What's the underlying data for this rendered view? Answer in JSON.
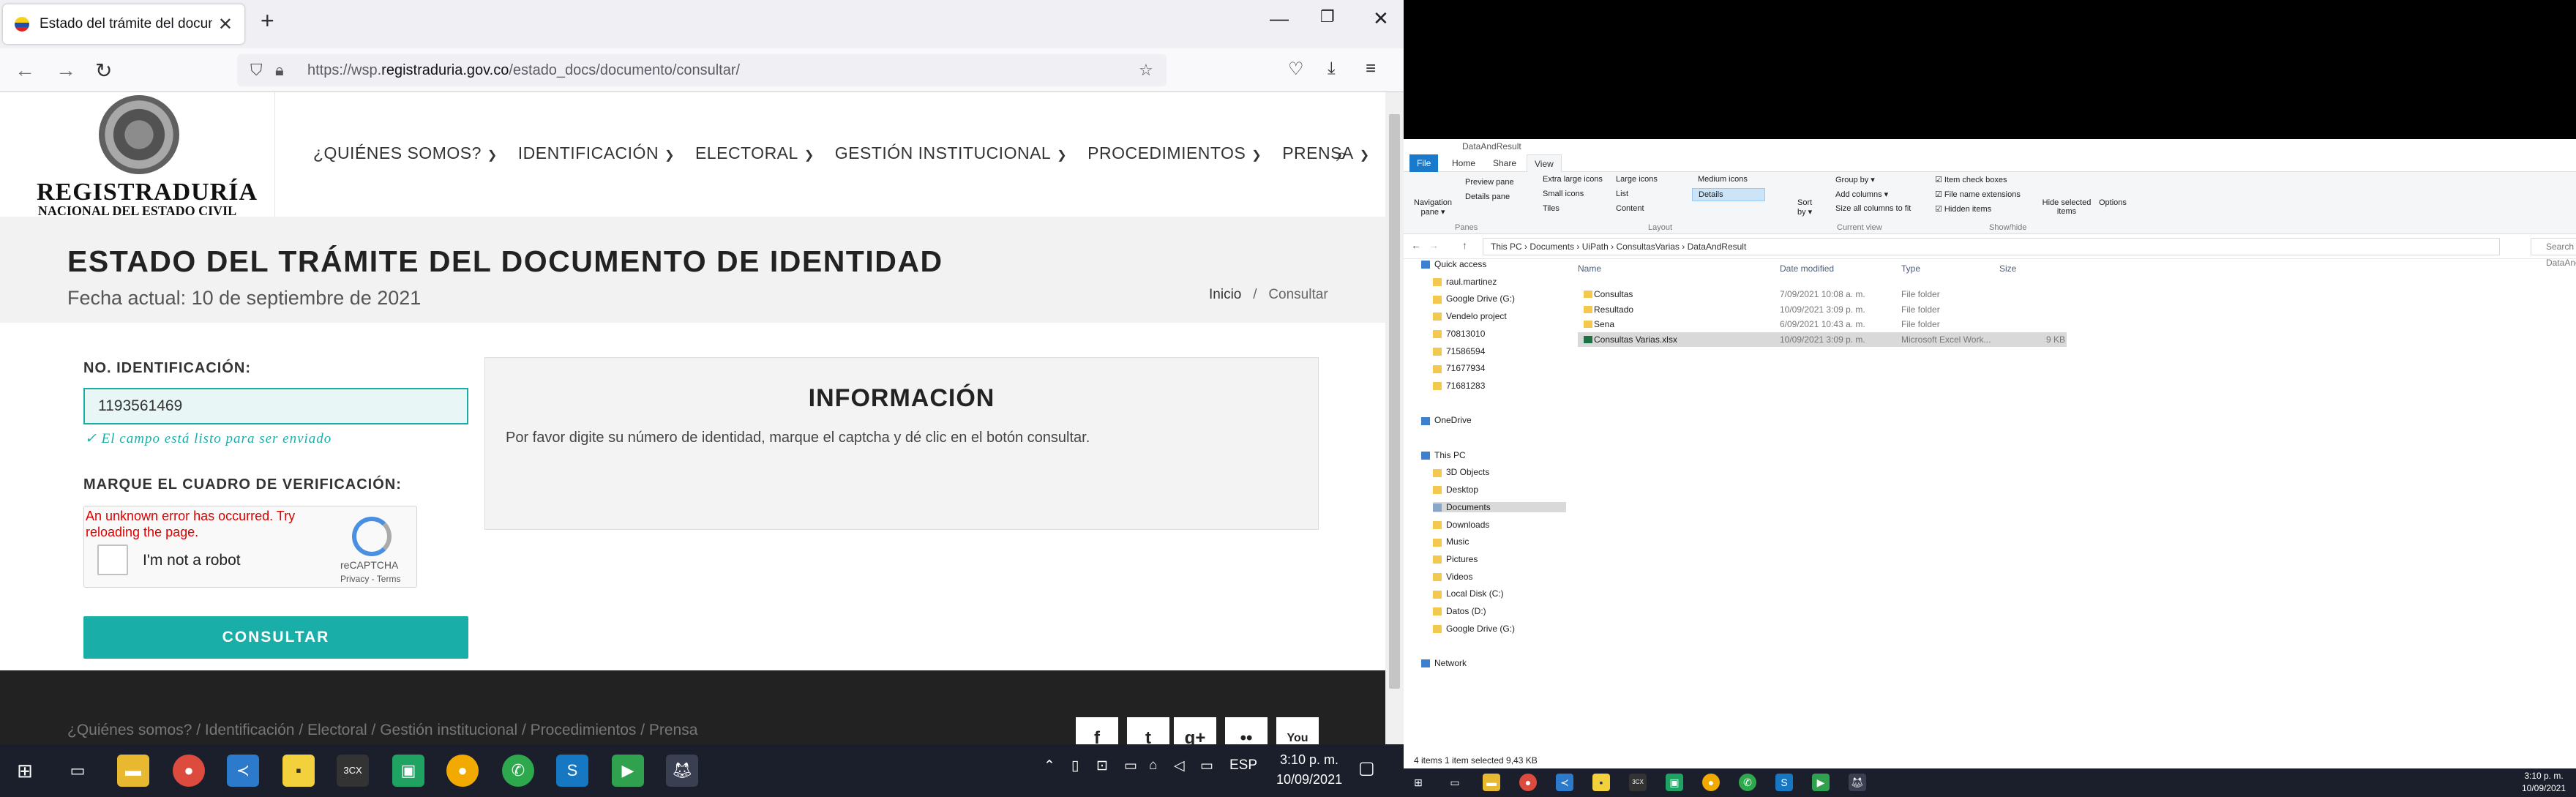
{
  "browser": {
    "tab_title": "Estado del trámite del documento",
    "url_prefix": "https://wsp.",
    "url_domain": "registraduria.gov.co",
    "url_path": "/estado_docs/documento/consultar/"
  },
  "site": {
    "logo_main": "REGISTRADURÍA",
    "logo_sub": "NACIONAL DEL ESTADO CIVIL",
    "menu": [
      "¿QUIÉNES SOMOS?",
      "IDENTIFICACIÓN",
      "ELECTORAL",
      "GESTIÓN INSTITUCIONAL",
      "PROCEDIMIENTOS",
      "PRENSA"
    ],
    "title": "ESTADO DEL TRÁMITE DEL DOCUMENTO DE IDENTIDAD",
    "fecha": "Fecha actual: 10 de septiembre de 2021",
    "crumb_home": "Inicio",
    "crumb_sep": "/",
    "crumb_current": "Consultar"
  },
  "form": {
    "id_label": "NO. IDENTIFICACIÓN:",
    "id_value": "1193561469",
    "ok_msg": "✓ El campo está listo para ser enviado",
    "captcha_label": "MARQUE EL CUADRO DE VERIFICACIÓN:",
    "captcha_error": "An unknown error has occurred. Try reloading the page.",
    "captcha_text": "I'm not a robot",
    "captcha_brand": "reCAPTCHA",
    "captcha_links": "Privacy - Terms",
    "submit": "CONSULTAR"
  },
  "info": {
    "title": "INFORMACIÓN",
    "text": "Por favor digite su número de identidad, marque el captcha y dé clic en el botón consultar."
  },
  "footer": {
    "links": "¿Quiénes somos?  /  Identificación  /  Electoral  /  Gestión institucional  /  Procedimientos  /  Prensa",
    "social": [
      "f",
      "t",
      "g+",
      "••",
      "You"
    ]
  },
  "taskbar": {
    "lang": "ESP",
    "time": "3:10 p. m.",
    "date": "10/09/2021"
  },
  "explorer": {
    "title": "DataAndResult",
    "tabs": [
      "File",
      "Home",
      "Share",
      "View"
    ],
    "ribbon": {
      "nav_pane": "Navigation pane ▾",
      "preview": "Preview pane",
      "details_pane": "Details pane",
      "panes_group": "Panes",
      "extra_large": "Extra large icons",
      "large": "Large icons",
      "medium": "Medium icons",
      "small": "Small icons",
      "list": "List",
      "details": "Details",
      "tiles": "Tiles",
      "content": "Content",
      "layout_group": "Layout",
      "sort": "Sort by ▾",
      "group_by": "Group by ▾",
      "add_cols": "Add columns ▾",
      "size_cols": "Size all columns to fit",
      "current_group": "Current view",
      "item_check": "Item check boxes",
      "file_ext": "File name extensions",
      "hidden": "Hidden items",
      "hide_sel": "Hide selected items",
      "options": "Options",
      "showhide_group": "Show/hide"
    },
    "breadcrumb": [
      "This PC",
      "Documents",
      "UiPath",
      "ConsultasVarias",
      "DataAndResult"
    ],
    "search_placeholder": "Search DataAndRe...",
    "nav": [
      {
        "label": "Quick access",
        "indent": 0
      },
      {
        "label": "raul.martinez",
        "indent": 1
      },
      {
        "label": "Google Drive (G:)",
        "indent": 1
      },
      {
        "label": "Vendelo project",
        "indent": 1
      },
      {
        "label": "70813010",
        "indent": 1
      },
      {
        "label": "71586594",
        "indent": 1
      },
      {
        "label": "71677934",
        "indent": 1
      },
      {
        "label": "71681283",
        "indent": 1
      },
      {
        "label": "",
        "indent": 0
      },
      {
        "label": "OneDrive",
        "indent": 0
      },
      {
        "label": "",
        "indent": 0
      },
      {
        "label": "This PC",
        "indent": 0
      },
      {
        "label": "3D Objects",
        "indent": 1
      },
      {
        "label": "Desktop",
        "indent": 1
      },
      {
        "label": "Documents",
        "indent": 1
      },
      {
        "label": "Downloads",
        "indent": 1
      },
      {
        "label": "Music",
        "indent": 1
      },
      {
        "label": "Pictures",
        "indent": 1
      },
      {
        "label": "Videos",
        "indent": 1
      },
      {
        "label": "Local Disk (C:)",
        "indent": 1
      },
      {
        "label": "Datos (D:)",
        "indent": 1
      },
      {
        "label": "Google Drive (G:)",
        "indent": 1
      },
      {
        "label": "",
        "indent": 0
      },
      {
        "label": "Network",
        "indent": 0
      }
    ],
    "columns": [
      "Name",
      "Date modified",
      "Type",
      "Size"
    ],
    "files": [
      {
        "name": "Consultas",
        "date": "7/09/2021 10:08 a. m.",
        "type": "File folder",
        "size": ""
      },
      {
        "name": "Resultado",
        "date": "10/09/2021 3:09 p. m.",
        "type": "File folder",
        "size": ""
      },
      {
        "name": "Sena",
        "date": "6/09/2021 10:43 a. m.",
        "type": "File folder",
        "size": ""
      },
      {
        "name": "Consultas Varias.xlsx",
        "date": "10/09/2021 3:09 p. m.",
        "type": "Microsoft Excel Work...",
        "size": "9 KB"
      }
    ],
    "status": "4 items     1 item selected  9,43 KB",
    "time": "3:10 p. m.",
    "date": "10/09/2021"
  }
}
